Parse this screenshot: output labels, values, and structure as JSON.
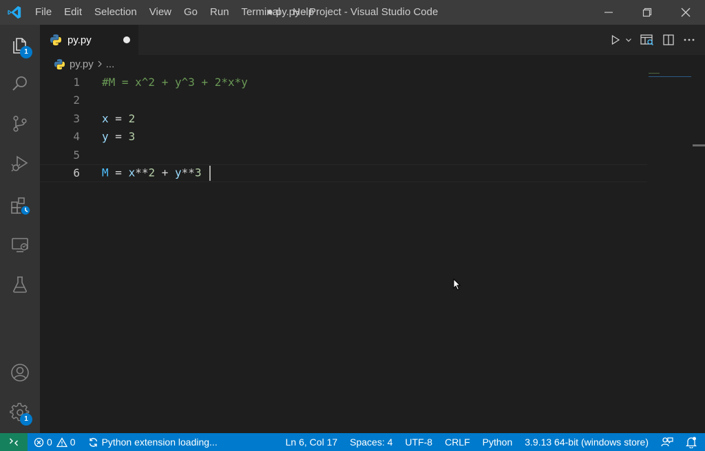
{
  "window": {
    "title": "● py.py - Project - Visual Studio Code"
  },
  "menu": {
    "items": [
      "File",
      "Edit",
      "Selection",
      "View",
      "Go",
      "Run",
      "Terminal",
      "Help"
    ]
  },
  "activity": {
    "explorer_badge": "1",
    "manage_badge": "1"
  },
  "tabs": [
    {
      "label": "py.py",
      "dirty": true
    }
  ],
  "breadcrumb": {
    "file": "py.py",
    "rest": "..."
  },
  "editor": {
    "active_line": 6,
    "lines": [
      {
        "number": "1",
        "text": "#M = x^2 + y^3 + 2*x*y"
      },
      {
        "number": "2",
        "text": ""
      },
      {
        "number": "3",
        "text": "x = 2"
      },
      {
        "number": "4",
        "text": "y = 3"
      },
      {
        "number": "5",
        "text": ""
      },
      {
        "number": "6",
        "text": "M = x**2 + y**3 "
      }
    ]
  },
  "statusbar": {
    "errors": "0",
    "warnings": "0",
    "loading": "Python extension loading...",
    "position": "Ln 6, Col 17",
    "spaces": "Spaces: 4",
    "encoding": "UTF-8",
    "eol": "CRLF",
    "language": "Python",
    "interpreter": "3.9.13 64-bit (windows store)"
  },
  "colors": {
    "accent": "#007acc",
    "remote": "#16825d",
    "titlebar": "#3c3c3c",
    "activitybar": "#333333",
    "editor_bg": "#1e1e1e"
  }
}
